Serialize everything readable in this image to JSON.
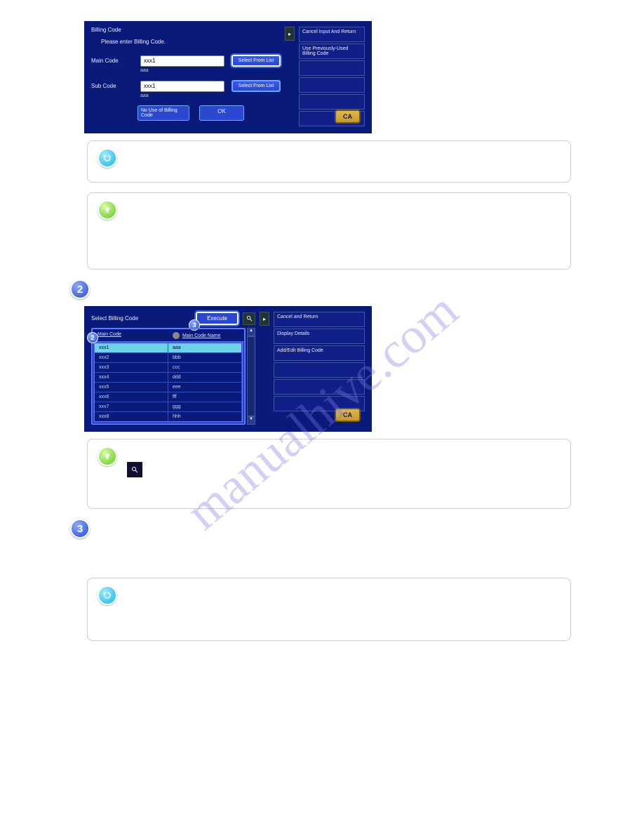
{
  "watermark": "manualhive.com",
  "panel1": {
    "title": "Billing Code",
    "subtitle": "Please enter Billing Code.",
    "main_label": "Main Code",
    "main_value": "xxx1",
    "main_hint": "aaa",
    "sub_label": "Sub Code",
    "sub_value": "xxx1",
    "sub_hint": "aaa",
    "select_btn": "Select From List",
    "nouse_btn": "No Use of Billing Code",
    "ok_btn": "OK",
    "side1": "Cancel Input And Return",
    "side2": "Use Previously-Used Billing Code",
    "ca": "CA"
  },
  "callout_a": {
    "text": ""
  },
  "callout_b": {
    "text": ""
  },
  "step2_num": "2",
  "panel2": {
    "title": "Select Billing Code",
    "execute": "Execute",
    "col1": "Main Code",
    "col2": "Main Code Name",
    "rows": [
      {
        "c1": "xxx1",
        "c2": "aaa"
      },
      {
        "c1": "xxx2",
        "c2": "bbb"
      },
      {
        "c1": "xxx3",
        "c2": "ccc"
      },
      {
        "c1": "xxx4",
        "c2": "ddd"
      },
      {
        "c1": "xxx5",
        "c2": "eee"
      },
      {
        "c1": "xxx6",
        "c2": "fff"
      },
      {
        "c1": "xxx7",
        "c2": "ggg"
      },
      {
        "c1": "xxx8",
        "c2": "hhh"
      }
    ],
    "side1": "Cancel and Return",
    "side2": "Display Details",
    "side3": "Add/Edit Billing Code",
    "ca": "CA",
    "bubble2": "2",
    "bubble3": "3"
  },
  "callout_c": {
    "line1": "",
    "line2": ""
  },
  "step3_num": "3",
  "callout_d": {
    "text": ""
  }
}
